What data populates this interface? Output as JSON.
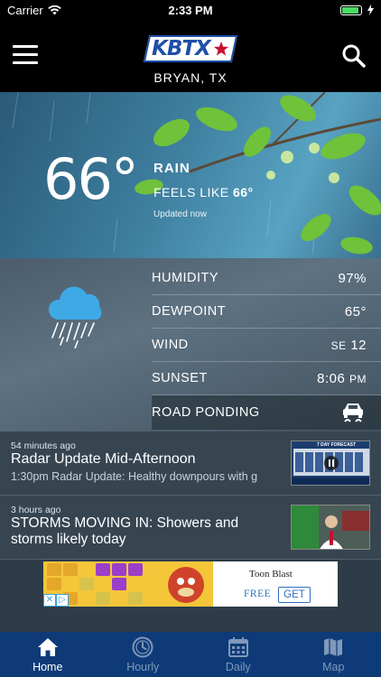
{
  "status_bar": {
    "carrier": "Carrier",
    "time": "2:33 PM",
    "battery_level": 0.9
  },
  "header": {
    "logo_text": "KBTX",
    "location": "BRYAN, TX"
  },
  "current": {
    "temperature": "66°",
    "condition": "RAIN",
    "feels_like_label": "FEELS LIKE",
    "feels_like_value": "66°",
    "updated": "Updated now"
  },
  "details": {
    "rows": [
      {
        "label": "HUMIDITY",
        "value": "97%"
      },
      {
        "label": "DEWPOINT",
        "value": "65°"
      },
      {
        "label": "WIND",
        "direction": "SE",
        "value": "12"
      },
      {
        "label": "SUNSET",
        "value": "8:06",
        "suffix": "PM"
      },
      {
        "label": "ROAD PONDING",
        "icon": "road-ponding-car-icon"
      }
    ]
  },
  "news": [
    {
      "time": "54 minutes ago",
      "title": "Radar Update Mid-Afternoon",
      "description": "1:30pm Radar Update: Healthy downpours with g",
      "thumb_caption": "7 DAY FORECAST"
    },
    {
      "time": "3 hours ago",
      "title": "STORMS MOVING IN: Showers and storms likely today"
    }
  ],
  "ad": {
    "title": "Toon Blast",
    "free": "FREE",
    "cta": "GET"
  },
  "tabs": [
    {
      "label": "Home",
      "icon": "home-icon",
      "active": true
    },
    {
      "label": "Hourly",
      "icon": "clock-icon",
      "active": false
    },
    {
      "label": "Daily",
      "icon": "calendar-icon",
      "active": false
    },
    {
      "label": "Map",
      "icon": "map-icon",
      "active": false
    }
  ],
  "colors": {
    "tabbar": "#0e3b78",
    "brand_blue": "#1f4fa8",
    "battery_green": "#4cd964"
  }
}
